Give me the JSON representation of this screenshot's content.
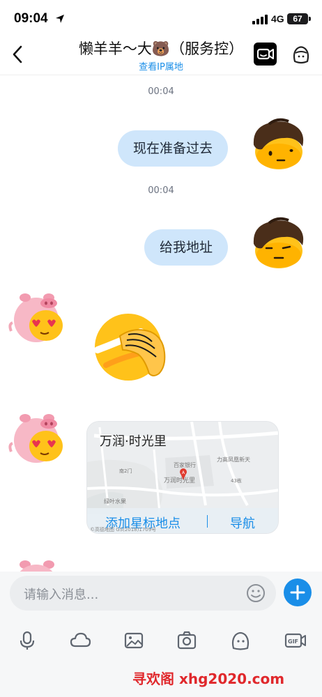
{
  "status_bar": {
    "time": "09:04",
    "network": "4G",
    "battery": "67"
  },
  "header": {
    "title": "懒羊羊～大🐻（服务控）",
    "subtitle": "查看IP属地"
  },
  "chat": {
    "timestamp_1": "00:04",
    "message_1": "现在准备过去",
    "timestamp_2": "00:04",
    "message_2": "给我地址",
    "location": {
      "title": "万润·时光里",
      "add_star_label": "添加星标地点",
      "navigate_label": "导航",
      "map_labels": [
        "力高凤凰新天",
        "万润时光里",
        "绿叶水果",
        "百家银行",
        "南2门",
        "43栋"
      ],
      "copyright": "©高德地图 GS(2018)1709号"
    }
  },
  "input": {
    "placeholder": "请输入消息..."
  },
  "toolbar": {
    "items": [
      "mic-icon",
      "cloud-icon",
      "image-icon",
      "camera-icon",
      "sticker-icon",
      "gif-icon"
    ]
  },
  "watermark": "寻欢阁 xhg2020.com",
  "colors": {
    "accent": "#1a8ee8",
    "bubble": "#cfe6fb",
    "watermark": "#e0282c"
  }
}
